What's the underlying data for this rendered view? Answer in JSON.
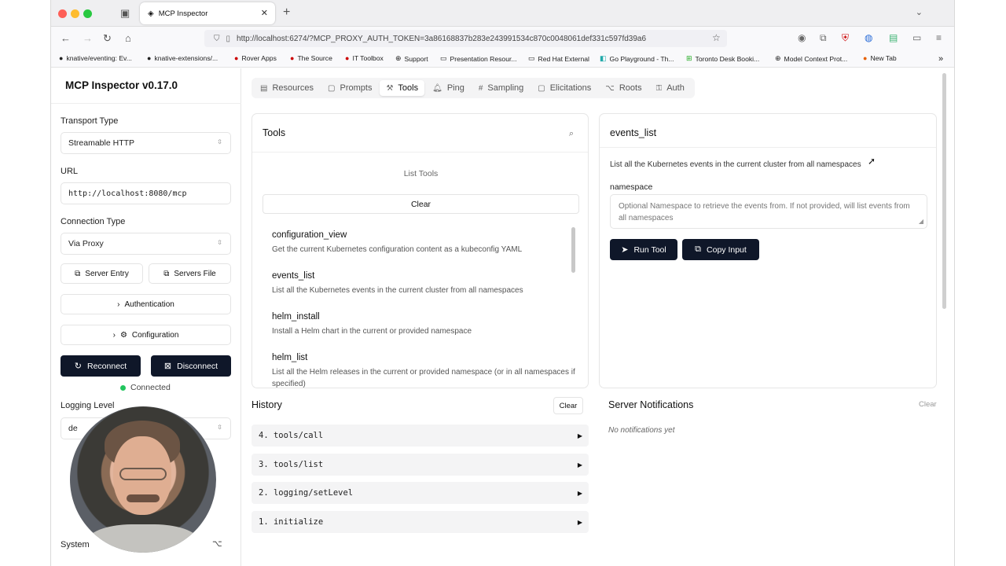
{
  "browser": {
    "tab_title": "MCP Inspector",
    "url": "http://localhost:6274/?MCP_PROXY_AUTH_TOKEN=3a86168837b283e243991534c870c0048061def331c597fd39a6",
    "bookmarks": [
      {
        "icon": "github-icon",
        "label": "knative/eventing: Ev..."
      },
      {
        "icon": "github-icon",
        "label": "knative-extensions/..."
      },
      {
        "icon": "redhat-icon",
        "label": "Rover Apps"
      },
      {
        "icon": "redhat-icon",
        "label": "The Source"
      },
      {
        "icon": "redhat-icon",
        "label": "IT Toolbox"
      },
      {
        "icon": "globe-icon",
        "label": "Support"
      },
      {
        "icon": "folder-icon",
        "label": "Presentation Resour..."
      },
      {
        "icon": "folder-icon",
        "label": "Red Hat External"
      },
      {
        "icon": "gopher-icon",
        "label": "Go Playground - Th..."
      },
      {
        "icon": "plus-square-icon",
        "label": "Toronto Desk Booki..."
      },
      {
        "icon": "globe-icon",
        "label": "Model Context Prot..."
      },
      {
        "icon": "firefox-icon",
        "label": "New Tab"
      }
    ]
  },
  "sidebar": {
    "title": "MCP Inspector v0.17.0",
    "transport_label": "Transport Type",
    "transport_value": "Streamable HTTP",
    "url_label": "URL",
    "url_value": "http://localhost:8080/mcp",
    "connection_label": "Connection Type",
    "connection_value": "Via Proxy",
    "server_entry": "Server Entry",
    "servers_file": "Servers File",
    "authentication": "Authentication",
    "configuration": "Configuration",
    "reconnect": "Reconnect",
    "disconnect": "Disconnect",
    "status": "Connected",
    "logging_label": "Logging Level",
    "logging_value": "de",
    "theme_value": "System"
  },
  "nav": {
    "tabs": [
      {
        "icon": "resources-icon",
        "label": "Resources",
        "active": false
      },
      {
        "icon": "prompts-icon",
        "label": "Prompts",
        "active": false
      },
      {
        "icon": "tools-icon",
        "label": "Tools",
        "active": true
      },
      {
        "icon": "ping-icon",
        "label": "Ping",
        "active": false
      },
      {
        "icon": "sampling-icon",
        "label": "Sampling",
        "active": false
      },
      {
        "icon": "elicitations-icon",
        "label": "Elicitations",
        "active": false
      },
      {
        "icon": "roots-icon",
        "label": "Roots",
        "active": false
      },
      {
        "icon": "auth-icon",
        "label": "Auth",
        "active": false
      }
    ]
  },
  "tools_panel": {
    "title": "Tools",
    "list_tools": "List Tools",
    "clear": "Clear",
    "items": [
      {
        "name": "configuration_view",
        "desc": "Get the current Kubernetes configuration content as a kubeconfig YAML"
      },
      {
        "name": "events_list",
        "desc": "List all the Kubernetes events in the current cluster from all namespaces"
      },
      {
        "name": "helm_install",
        "desc": "Install a Helm chart in the current or provided namespace"
      },
      {
        "name": "helm_list",
        "desc": "List all the Helm releases in the current or provided namespace (or in all namespaces if specified)"
      }
    ]
  },
  "tool_detail": {
    "title": "events_list",
    "description": "List all the Kubernetes events in the current cluster from all namespaces",
    "param_label": "namespace",
    "param_placeholder": "Optional Namespace to retrieve the events from. If not provided, will list events from all namespaces",
    "run_tool": "Run Tool",
    "copy_input": "Copy Input"
  },
  "history": {
    "title": "History",
    "clear": "Clear",
    "items": [
      "4. tools/call",
      "3. tools/list",
      "2. logging/setLevel",
      "1. initialize"
    ]
  },
  "notifications": {
    "title": "Server Notifications",
    "clear": "Clear",
    "empty": "No notifications yet"
  }
}
